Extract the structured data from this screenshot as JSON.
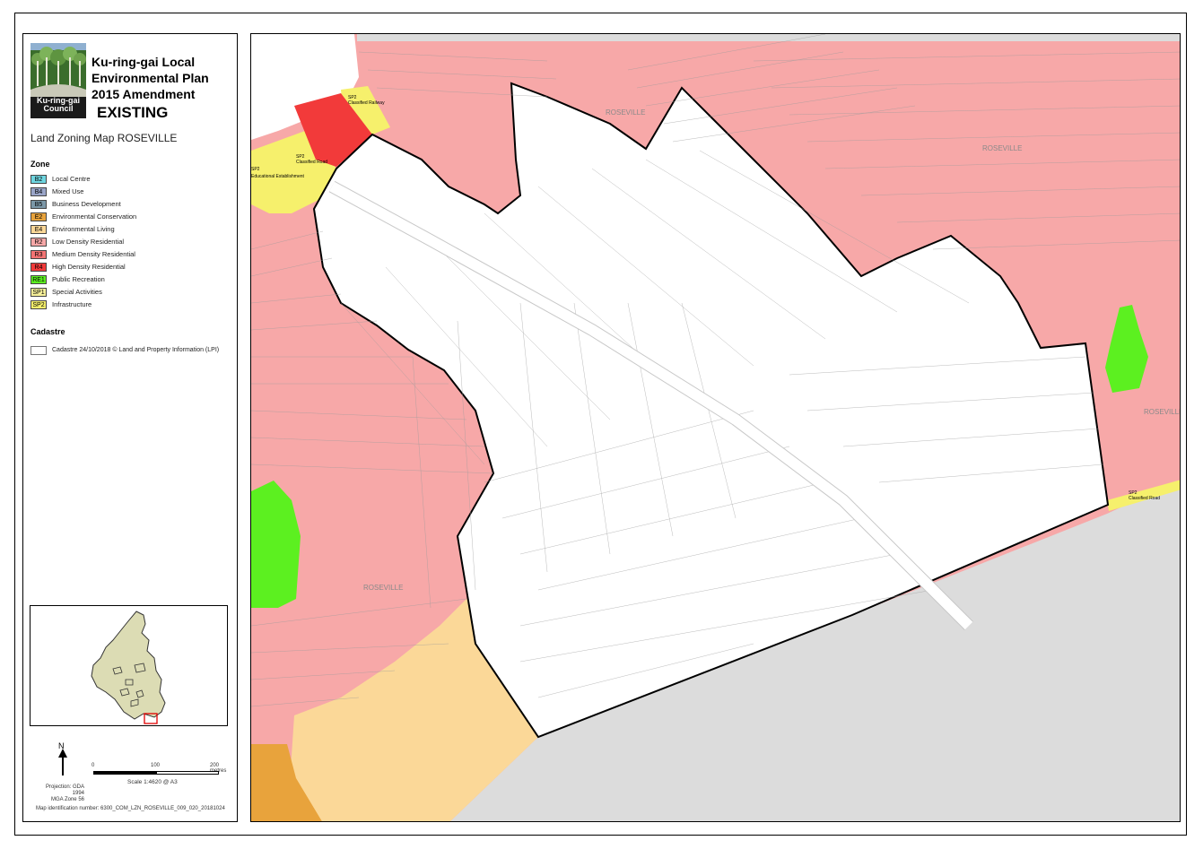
{
  "header": {
    "title_lines": [
      "Ku-ring-gai Local",
      "Environmental Plan",
      "2015 Amendment"
    ],
    "status": "EXISTING",
    "map_title": "Land Zoning Map ROSEVILLE",
    "logo_text": [
      "Ku-ring-gai",
      "Council"
    ]
  },
  "legend": {
    "zone_heading": "Zone",
    "zones": [
      {
        "code": "B2",
        "label": "Local Centre",
        "color": "#6fd6e0"
      },
      {
        "code": "B4",
        "label": "Mixed Use",
        "color": "#9aa5c8"
      },
      {
        "code": "B5",
        "label": "Business Development",
        "color": "#7c98a8"
      },
      {
        "code": "E2",
        "label": "Environmental Conservation",
        "color": "#e8a33c"
      },
      {
        "code": "E4",
        "label": "Environmental Living",
        "color": "#fbd898"
      },
      {
        "code": "R2",
        "label": "Low Density Residential",
        "color": "#f7a8a8"
      },
      {
        "code": "R3",
        "label": "Medium Density Residential",
        "color": "#f37474"
      },
      {
        "code": "R4",
        "label": "High Density Residential",
        "color": "#f23a3a"
      },
      {
        "code": "RE1",
        "label": "Public Recreation",
        "color": "#5cf020"
      },
      {
        "code": "SP1",
        "label": "Special Activities",
        "color": "#f6f09a"
      },
      {
        "code": "SP2",
        "label": "Infrastructure",
        "color": "#f6f06c"
      }
    ],
    "cadastre_heading": "Cadastre",
    "cadastre_label": "Cadastre 24/10/2018 © Land and Property Information (LPI)"
  },
  "scalebar": {
    "north": "N",
    "ticks": [
      "0",
      "100",
      "200 metres"
    ],
    "scale_text": "Scale   1:4620   @ A3",
    "projection": [
      "Projection: GDA 1994",
      "MGA Zone 56"
    ]
  },
  "map_identification": "Map identification number: 6300_COM_LZN_ROSEVILLE_009_020_20181024",
  "map_labels": {
    "suburb": "ROSEVILLE",
    "sp2_rail": "Classified Railway",
    "sp2_road": "Classified Road",
    "sp2_edu": "Educational Establishment",
    "sp2_code": "SP2"
  },
  "colors": {
    "r2": "#f7a8a8",
    "r4": "#f23a3a",
    "re1": "#5cf020",
    "e4": "#fbd898",
    "e2": "#e8a33c",
    "sp2": "#f6f06c",
    "outside": "#dcdcdc"
  }
}
